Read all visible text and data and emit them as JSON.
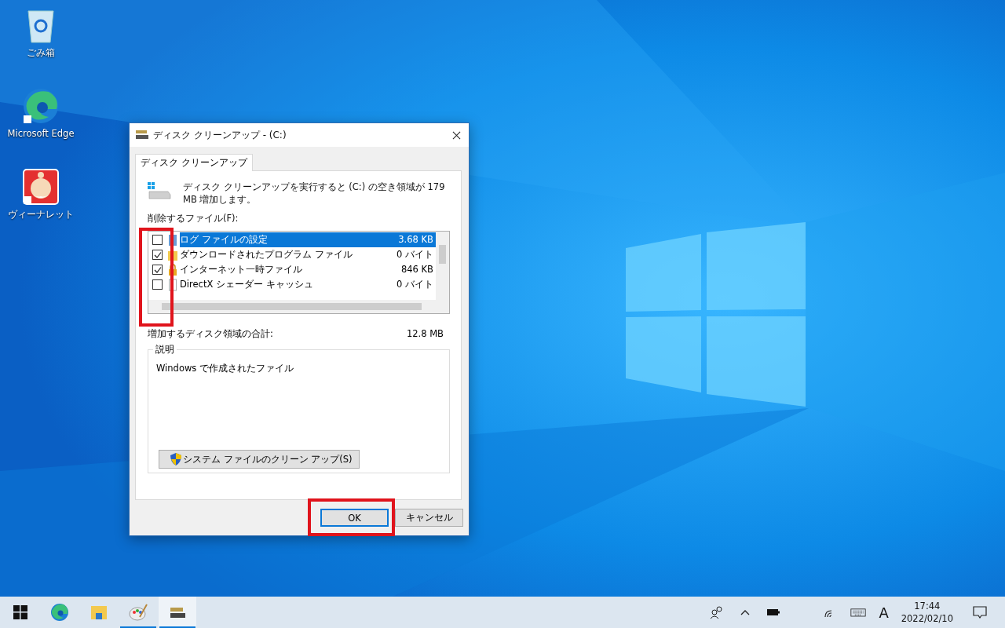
{
  "desktop_icons": [
    {
      "label": "ごみ箱",
      "kind": "recycle"
    },
    {
      "label": "Microsoft Edge",
      "kind": "edge"
    },
    {
      "label": "ヴィーナレット",
      "kind": "app"
    }
  ],
  "dialog": {
    "title": "ディスク クリーンアップ - (C:)",
    "tabs": [
      {
        "label": "ディスク クリーンアップ",
        "selected": true
      }
    ],
    "message": "ディスク クリーンアップを実行すると (C:) の空き領域が 179 MB 増加します。",
    "files_label": "削除するファイル(F):",
    "files": [
      {
        "name": "ログ ファイルの設定",
        "size": "3.68 KB",
        "checked": false,
        "selected": true,
        "kind": "log"
      },
      {
        "name": "ダウンロードされたプログラム ファイル",
        "size": "0 バイト",
        "checked": true,
        "selected": false,
        "kind": "folder"
      },
      {
        "name": "インターネット一時ファイル",
        "size": "846 KB",
        "checked": true,
        "selected": false,
        "kind": "lock"
      },
      {
        "name": "DirectX シェーダー キャッシュ",
        "size": "0 バイト",
        "checked": false,
        "selected": false,
        "kind": "doc"
      }
    ],
    "total_label": "増加するディスク領域の合計:",
    "total_value": "12.8 MB",
    "description_title": "説明",
    "description": "Windows で作成されたファイル",
    "system_button": "システム ファイルのクリーン アップ(S)",
    "buttons": [
      {
        "label": "OK",
        "default": true
      },
      {
        "label": "キャンセル",
        "default": false
      }
    ]
  },
  "taskbar": {
    "apps": [
      {
        "kind": "start",
        "running": false,
        "active": false
      },
      {
        "kind": "edge",
        "running": false,
        "active": false
      },
      {
        "kind": "explorer",
        "running": false,
        "active": false
      },
      {
        "kind": "paint",
        "running": true,
        "active": false
      },
      {
        "kind": "cleanup",
        "running": true,
        "active": true
      }
    ],
    "ime": "A",
    "time": "17:44",
    "date": "2022/02/10"
  }
}
